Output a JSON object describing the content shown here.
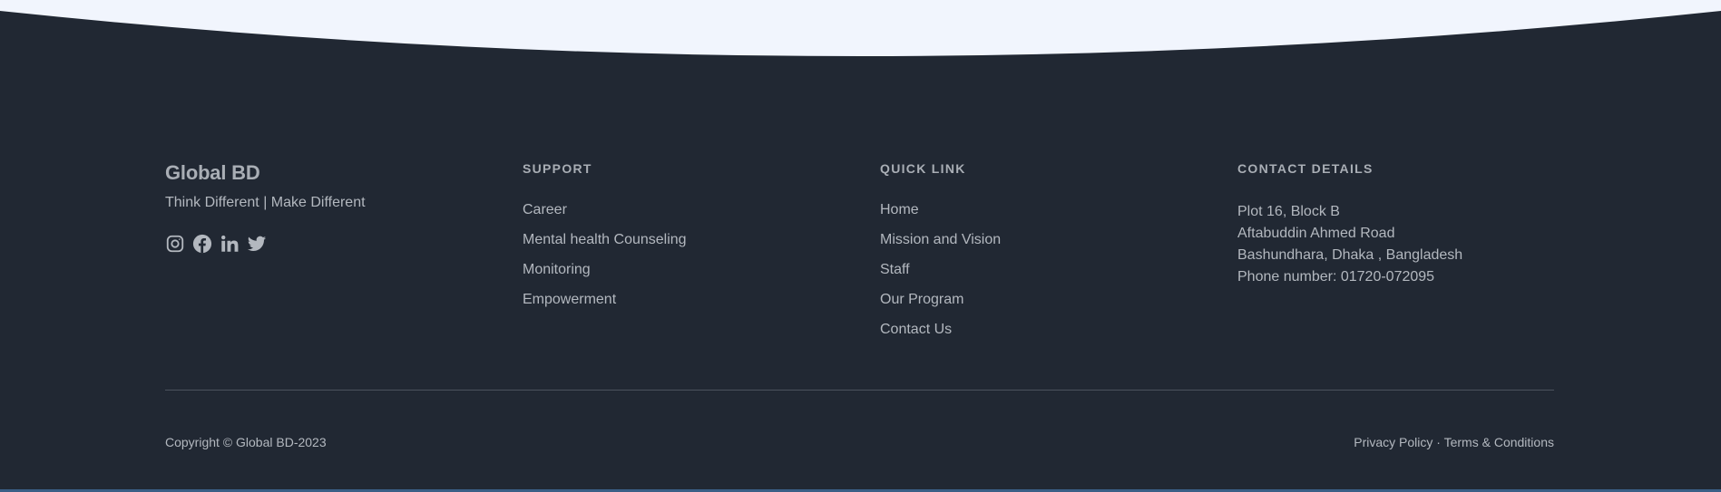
{
  "colors": {
    "background": "#212833",
    "wave": "#f1f5fd",
    "text": "#b3b8bf",
    "heading": "#a9aeb5",
    "divider": "#4c535e",
    "bottom_strip": "#3a5f86"
  },
  "brand": {
    "name": "Global BD",
    "tagline": "Think Different | Make Different",
    "social": [
      {
        "icon": "instagram-icon"
      },
      {
        "icon": "facebook-icon"
      },
      {
        "icon": "linkedin-icon"
      },
      {
        "icon": "twitter-icon"
      }
    ]
  },
  "support": {
    "heading": "SUPPORT",
    "items": [
      "Career",
      "Mental health Counseling",
      "Monitoring",
      "Empowerment"
    ]
  },
  "quick_link": {
    "heading": "QUICK LINK",
    "items": [
      "Home",
      "Mission and Vision",
      "Staff",
      "Our Program",
      "Contact Us"
    ]
  },
  "contact": {
    "heading": "CONTACT DETAILS",
    "lines": [
      "Plot 16, Block B",
      "Aftabuddin Ahmed Road",
      "Bashundhara, Dhaka , Bangladesh",
      "Phone number: 01720-072095"
    ]
  },
  "bottom": {
    "copyright": "Copyright © Global BD-2023",
    "privacy": "Privacy Policy",
    "separator": "·",
    "terms": "Terms & Conditions"
  }
}
